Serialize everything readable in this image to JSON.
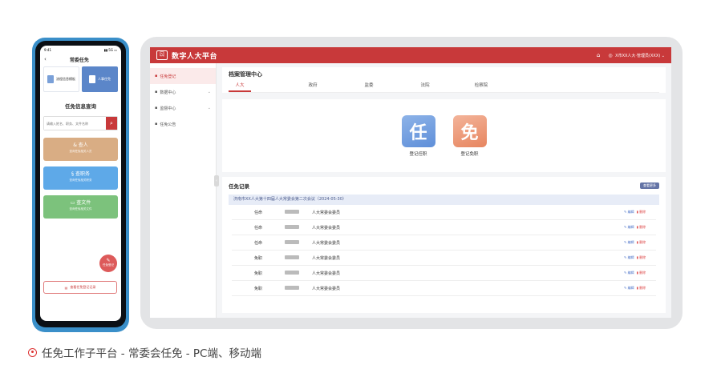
{
  "pc": {
    "app_title": "数字人大平台",
    "logo_text": "ㄖ",
    "user_text": "X市XX人大·管理员(XXX)",
    "sidebar": [
      {
        "label": "任免登记",
        "has_arrow": false
      },
      {
        "label": "数据中心",
        "has_arrow": true
      },
      {
        "label": "监督中心",
        "has_arrow": true
      },
      {
        "label": "任免公告",
        "has_arrow": false
      }
    ],
    "panel_title": "档案管理中心",
    "tabs": [
      "人大",
      "政府",
      "监委",
      "法院",
      "检察院"
    ],
    "actions": [
      {
        "glyph": "任",
        "label": "登记任职",
        "color": "blue"
      },
      {
        "glyph": "免",
        "label": "登记免职",
        "color": "orange"
      }
    ],
    "records_title": "任免记录",
    "records_button": "查看更多",
    "meeting": "济南市XX人大第十四届人大常委会第二次会议（2024-05-30）",
    "records": [
      {
        "type": "任命",
        "post": "人大常委会委员"
      },
      {
        "type": "任命",
        "post": "人大常委会委员"
      },
      {
        "type": "任命",
        "post": "人大常委会委员"
      },
      {
        "type": "免职",
        "post": "人大常委会委员"
      },
      {
        "type": "免职",
        "post": "人大常委会委员"
      },
      {
        "type": "免职",
        "post": "人大常委会委员"
      }
    ],
    "op_edit": "编辑",
    "op_delete": "删除"
  },
  "mobile": {
    "status_time": "9:41",
    "status_right": "▮▮ 5G ▭",
    "nav_title": "常委任免",
    "tabs": [
      "流程信息模板",
      "人事任免"
    ],
    "query_title": "任免信息查询",
    "search_placeholder": "请输入姓名、职务、文件名称",
    "cards": [
      {
        "title": "& 查人",
        "sub": "查询任免相关人员"
      },
      {
        "title": "§ 查职务",
        "sub": "查询任免相关职务"
      },
      {
        "title": "▭ 查文件",
        "sub": "查询任免相关文件"
      }
    ],
    "float_label": "任免登记",
    "record_button": "查看任免登记记录"
  },
  "caption": "任免工作子平台 - 常委会任免 - PC端、移动端",
  "colors": {
    "brand_red": "#c8393a",
    "blue": "#5f8fd9",
    "orange": "#e7855f"
  }
}
